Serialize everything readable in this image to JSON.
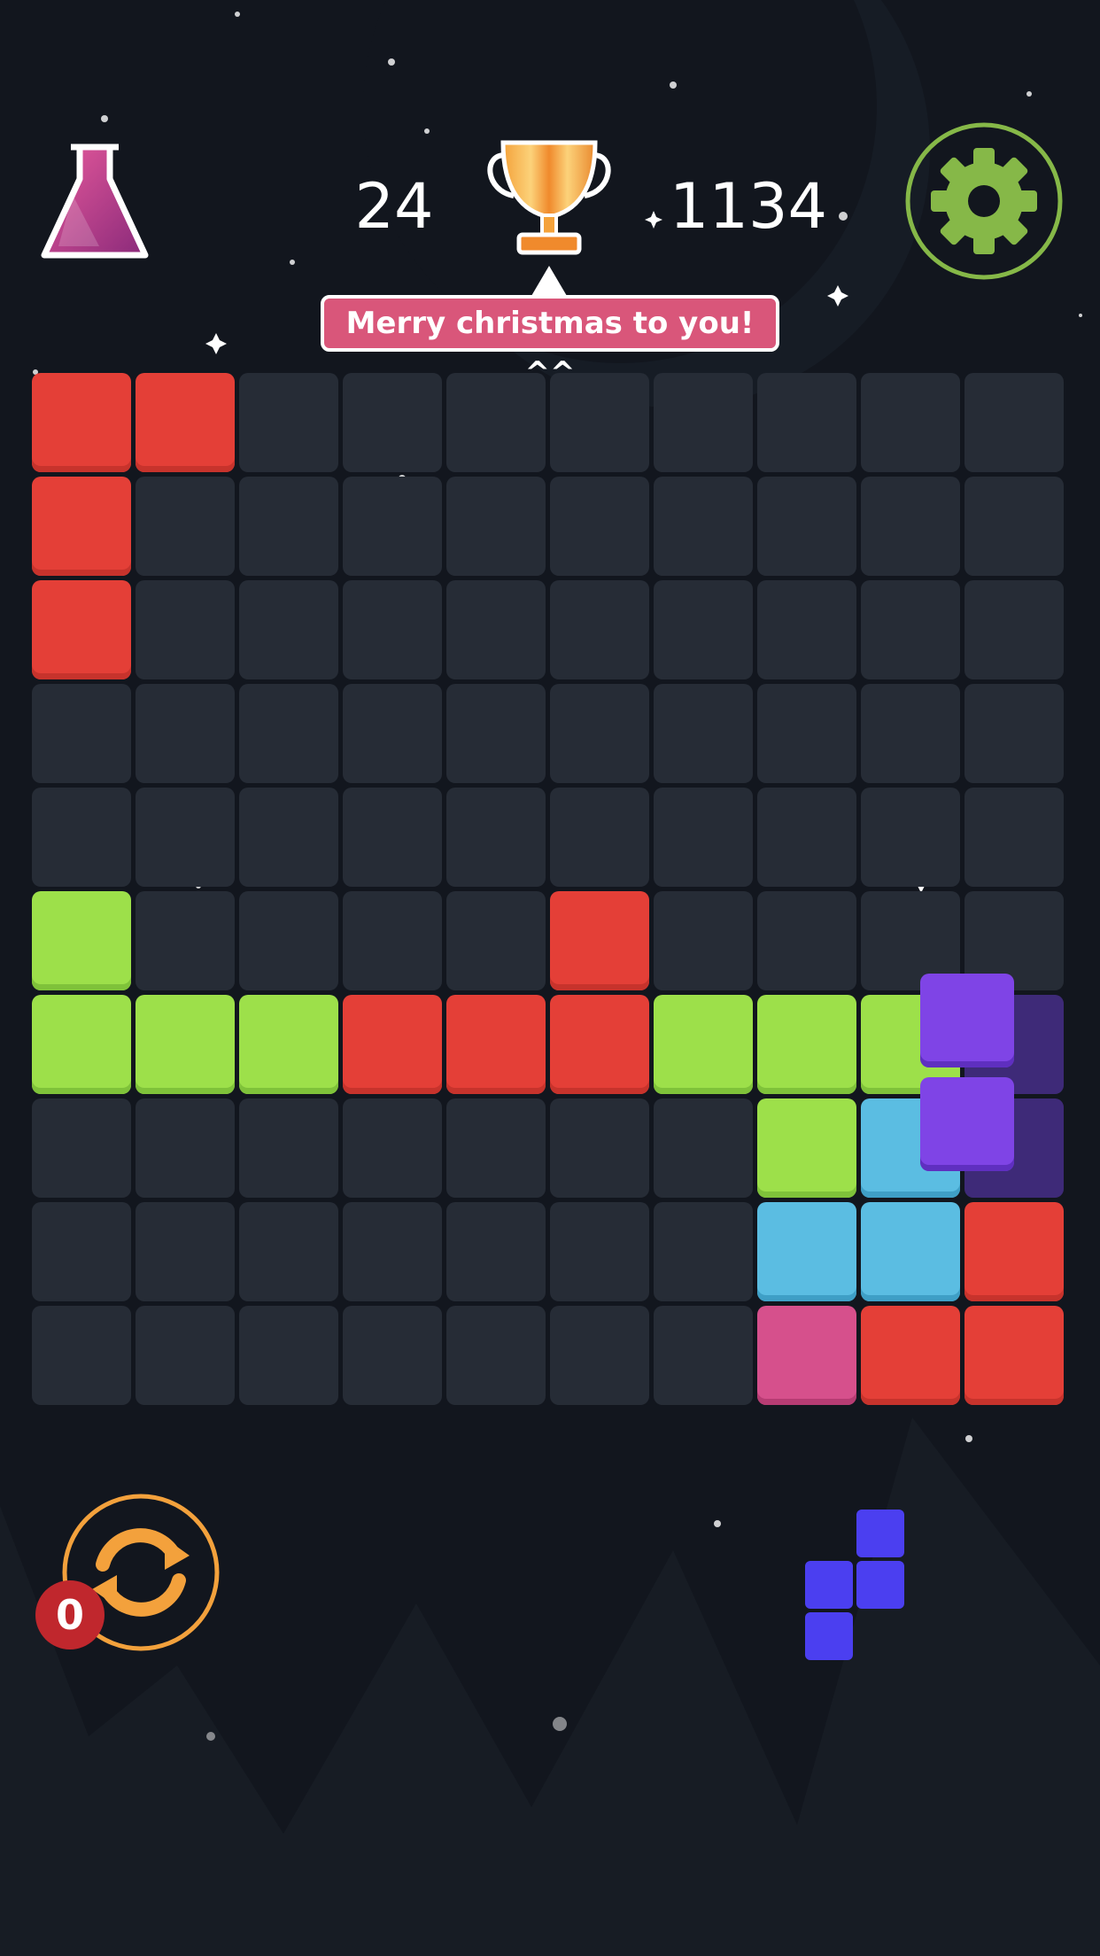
{
  "hud": {
    "score": "24",
    "best_score": "1134",
    "message": "Merry christmas to you! ^^"
  },
  "colors": {
    "background": "#12161e",
    "empty_cell": "#262c36",
    "red": "#e43f37",
    "green": "#9de04a",
    "blue": "#5bbde2",
    "pink": "#d6508c",
    "purple": "#7f44e6",
    "indigo": "#4b3ff0",
    "gear": "#86b848",
    "refresh": "#f3a13c",
    "badge": "#c0272d"
  },
  "board": {
    "rows": 10,
    "cols": 10,
    "grid": [
      [
        "red",
        "red",
        "",
        "",
        "",
        "",
        "",
        "",
        "",
        ""
      ],
      [
        "red",
        "",
        "",
        "",
        "",
        "",
        "",
        "",
        "",
        ""
      ],
      [
        "red",
        "",
        "",
        "",
        "",
        "",
        "",
        "",
        "",
        ""
      ],
      [
        "",
        "",
        "",
        "",
        "",
        "",
        "",
        "",
        "",
        ""
      ],
      [
        "",
        "",
        "",
        "",
        "",
        "",
        "",
        "",
        "",
        ""
      ],
      [
        "green",
        "",
        "",
        "",
        "",
        "red",
        "",
        "",
        "",
        ""
      ],
      [
        "green",
        "green",
        "green",
        "red",
        "red",
        "red",
        "green",
        "green",
        "green",
        ""
      ],
      [
        "",
        "",
        "",
        "",
        "",
        "",
        "",
        "green",
        "blue",
        ""
      ],
      [
        "",
        "",
        "",
        "",
        "",
        "",
        "",
        "blue",
        "blue",
        "red"
      ],
      [
        "",
        "",
        "",
        "",
        "",
        "",
        "",
        "pink",
        "red",
        "red"
      ]
    ]
  },
  "dragging_piece": {
    "color": "purple",
    "blocks": 2,
    "orientation": "vertical"
  },
  "next_piece": {
    "color": "indigo",
    "blocks": 4,
    "shape": "S-vertical"
  },
  "refresh": {
    "count": "0"
  },
  "icons": [
    "flask-icon",
    "trophy-icon",
    "gear-icon",
    "refresh-icon"
  ]
}
